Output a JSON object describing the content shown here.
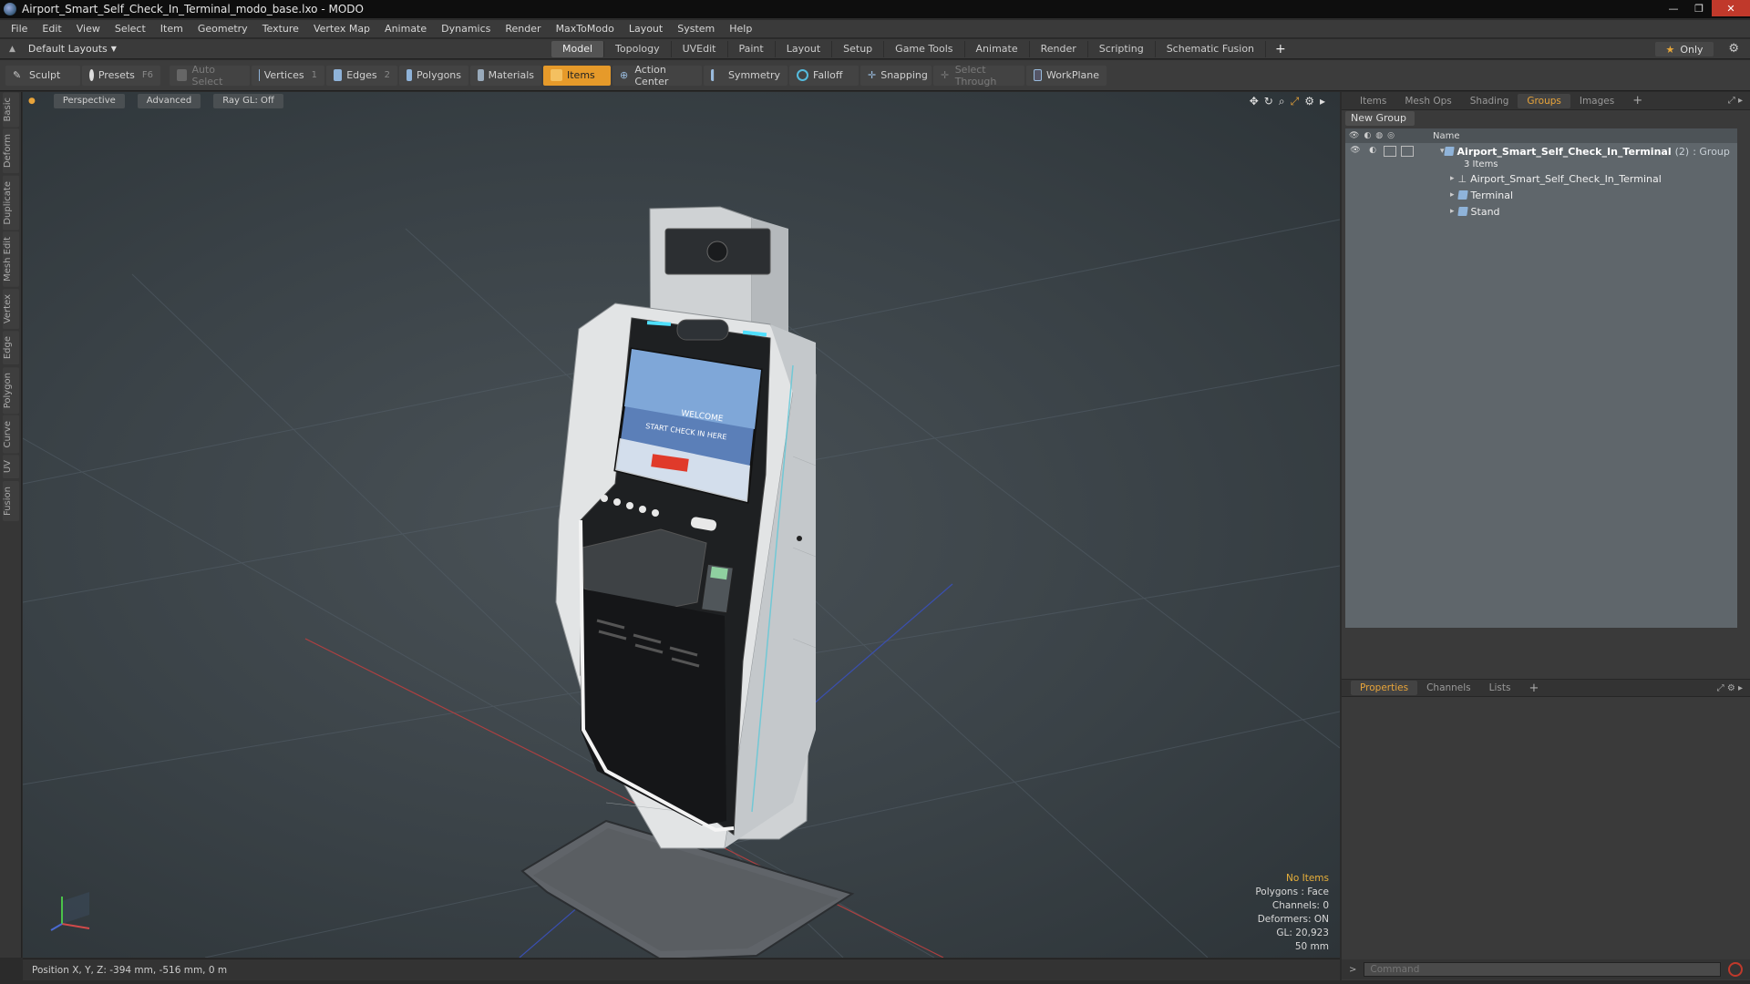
{
  "window": {
    "title": "Airport_Smart_Self_Check_In_Terminal_modo_base.lxo - MODO",
    "controls": [
      "—",
      "❐",
      "✕"
    ]
  },
  "menu": [
    "File",
    "Edit",
    "View",
    "Select",
    "Item",
    "Geometry",
    "Texture",
    "Vertex Map",
    "Animate",
    "Dynamics",
    "Render",
    "MaxToModo",
    "Layout",
    "System",
    "Help"
  ],
  "layoutbar": {
    "layout_name": "Default Layouts",
    "tabs": [
      "Model",
      "Topology",
      "UVEdit",
      "Paint",
      "Layout",
      "Setup",
      "Game Tools",
      "Animate",
      "Render",
      "Scripting",
      "Schematic Fusion"
    ],
    "active_tab": "Model",
    "only_label": "Only"
  },
  "toolbar": {
    "sculpt": "Sculpt",
    "presets": "Presets",
    "presets_key": "F6",
    "auto_select": "Auto Select",
    "vertices": "Vertices",
    "vertices_key": "1",
    "edges": "Edges",
    "edges_key": "2",
    "polygons": "Polygons",
    "materials": "Materials",
    "items": "Items",
    "action_center": "Action Center",
    "symmetry": "Symmetry",
    "falloff": "Falloff",
    "snapping": "Snapping",
    "select_through": "Select Through",
    "workplane": "WorkPlane"
  },
  "left_tabs": [
    "Basic",
    "Deform",
    "Duplicate",
    "Mesh Edit",
    "Vertex",
    "Edge",
    "Polygon",
    "Curve",
    "UV",
    "Fusion"
  ],
  "viewport": {
    "projection": "Perspective",
    "style": "Advanced",
    "raygl": "Ray GL: Off",
    "info": {
      "selection": "No Items",
      "polygons": "Polygons : Face",
      "channels": "Channels: 0",
      "deformers": "Deformers: ON",
      "gl": "GL: 20,923",
      "scale": "50 mm"
    },
    "screen_text": {
      "welcome": "WELCOME",
      "start": "START CHECK IN HERE"
    }
  },
  "status": {
    "position": "Position X, Y, Z:  -394 mm, -516 mm, 0 m"
  },
  "right_panel": {
    "tabs": [
      "Items",
      "Mesh Ops",
      "Shading",
      "Groups",
      "Images"
    ],
    "active_tab": "Groups",
    "new_group": "New Group",
    "column_name": "Name",
    "group": {
      "name": "Airport_Smart_Self_Check_In_Terminal",
      "count": "(2)",
      "type": ": Group",
      "items_count": "3 Items"
    },
    "children": [
      "Airport_Smart_Self_Check_In_Terminal",
      "Terminal",
      "Stand"
    ],
    "props_tabs": [
      "Properties",
      "Channels",
      "Lists"
    ],
    "active_props_tab": "Properties",
    "command_placeholder": "Command"
  },
  "colors": {
    "accent": "#e69a2a",
    "group_list_bg": "#5f666b"
  }
}
